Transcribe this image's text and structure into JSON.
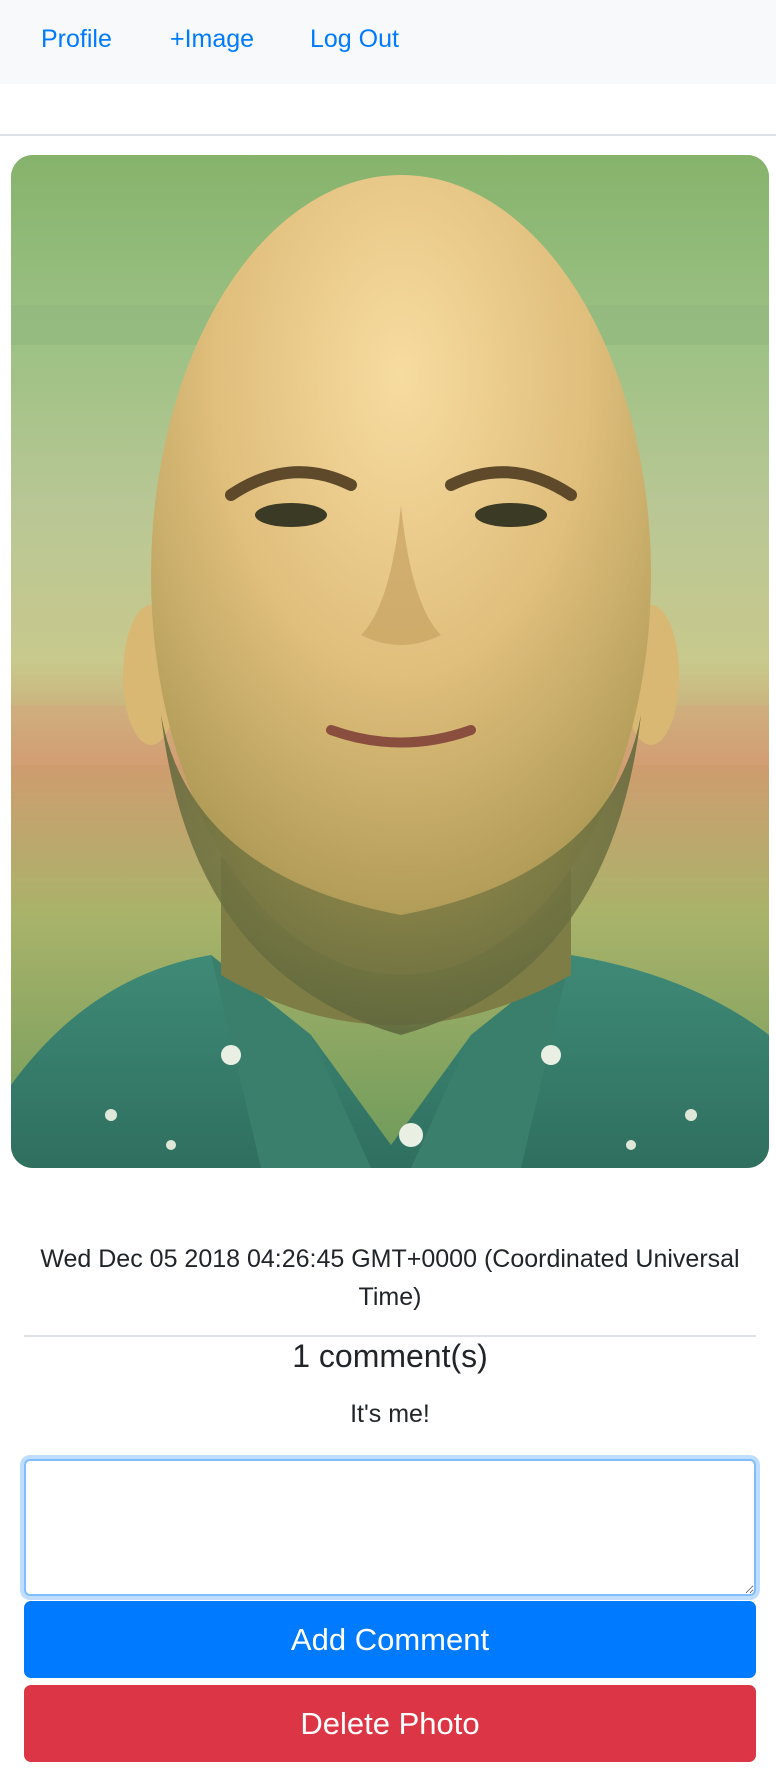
{
  "nav": {
    "profile_label": "Profile",
    "add_image_label": "+Image",
    "logout_label": "Log Out"
  },
  "photo": {
    "subject": "portrait-photo"
  },
  "post": {
    "timestamp": "Wed Dec 05 2018 04:26:45 GMT+0000 (Coordinated Universal Time)"
  },
  "comments": {
    "heading": "1 comment(s)",
    "items": [
      {
        "text": "It's me!"
      }
    ],
    "input_value": ""
  },
  "actions": {
    "add_comment_label": "Add Comment",
    "delete_photo_label": "Delete Photo"
  },
  "colors": {
    "link": "#007bff",
    "primary": "#007bff",
    "danger": "#dc3545",
    "navbar_bg": "#f8f9fa"
  }
}
